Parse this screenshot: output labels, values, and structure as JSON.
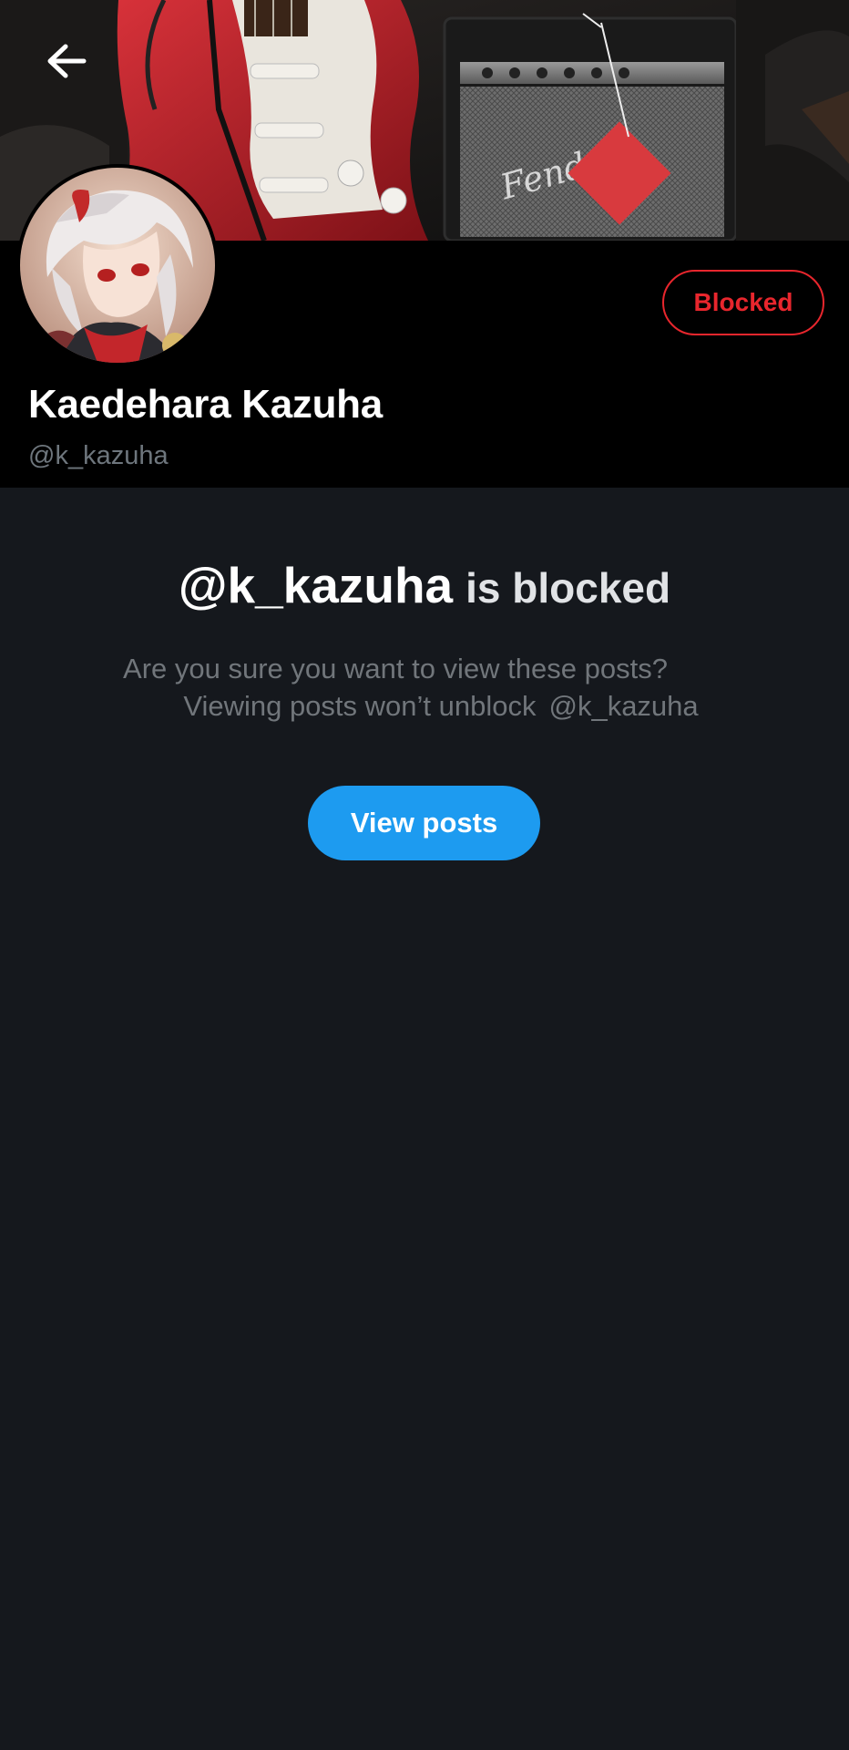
{
  "header": {
    "back_icon": "arrow-left-icon",
    "blocked_label": "Blocked"
  },
  "profile": {
    "display_name": "Kaedehara Kazuha",
    "handle": "@k_kazuha"
  },
  "blocked_notice": {
    "title_handle": "@k_kazuha",
    "title_suffix": "is blocked",
    "line1": "Are you sure you want to view these posts?",
    "line2_prefix": "Viewing posts won’t unblock",
    "line2_handle": "@k_kazuha",
    "view_posts_label": "View posts"
  },
  "colors": {
    "accent_blue": "#1d9bf0",
    "blocked_red": "#e8262d",
    "background": "#15181d",
    "header_bg": "#000000"
  }
}
